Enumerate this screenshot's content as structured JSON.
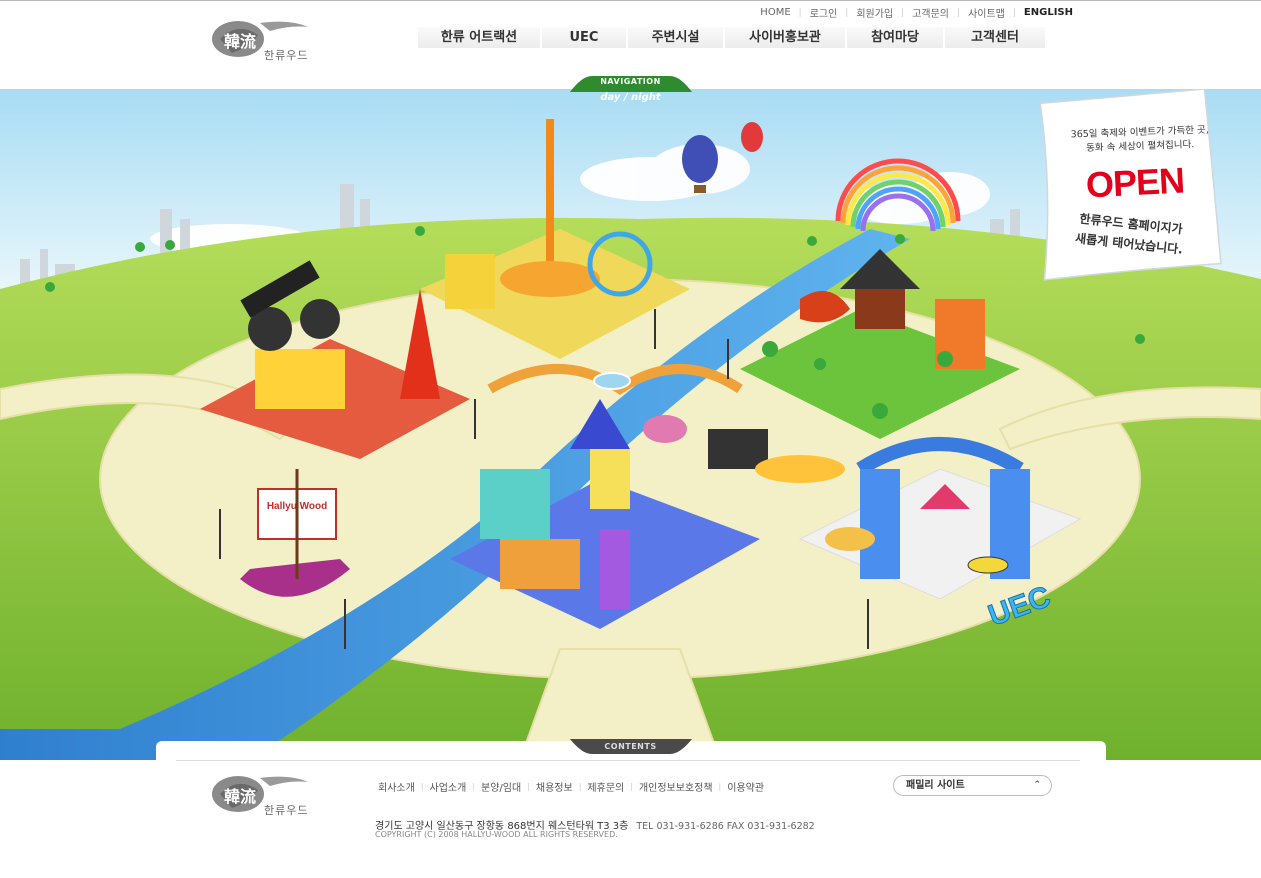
{
  "brand": {
    "logo_text": "한류우드"
  },
  "util_nav": [
    "HOME",
    "로그인",
    "회원가입",
    "고객문의",
    "사이트맵",
    "ENGLISH"
  ],
  "gnb": [
    "한류 어트랙션",
    "UEC",
    "주변시설",
    "사이버홍보관",
    "참여마당",
    "고객센터"
  ],
  "navigation": {
    "label": "NAVIGATION",
    "sub": "day / night"
  },
  "notice": {
    "line1": "365일 축제와 이벤트가 가득한 곳,",
    "line1b": "동화 속 세상이 펼쳐집니다.",
    "open": "OPEN",
    "line2": "한류우드 홈페이지가",
    "line2b": "새롭게 태어났습니다."
  },
  "map_labels": {
    "ship": "Hallyu Wood",
    "uec": "UEC"
  },
  "contents_label": "CONTENTS",
  "footer": {
    "links": [
      "회사소개",
      "사업소개",
      "분양/임대",
      "채용정보",
      "제휴문의",
      "개인정보보호정책",
      "이용약관"
    ],
    "address": "경기도 고양시 일산동구 장항동 868번지 웨스턴타워 T3 3층",
    "tel": "TEL 031-931-6286  FAX 031-931-6282",
    "copyright": "COPYRIGHT (C) 2008 HALLYU-WOOD ALL RIGHTS RESERVED.",
    "family_site": "패밀리 사이트"
  },
  "colors": {
    "sky": "#bfe6f7",
    "grass": "#8cc63f",
    "river": "#3a8fd6",
    "path": "#f3efc7",
    "accent": "#e2001a"
  }
}
